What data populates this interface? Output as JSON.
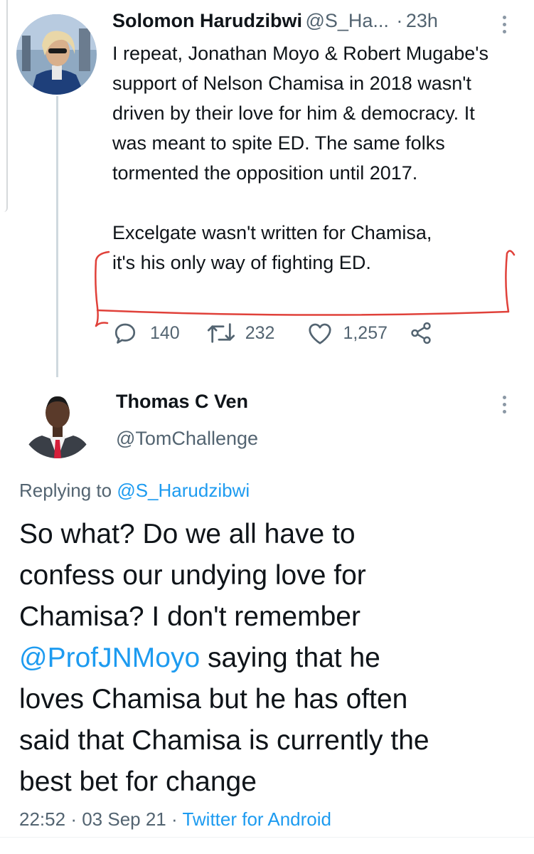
{
  "tweet1": {
    "name": "Solomon Harudzibwi",
    "handle": "@S_Ha...",
    "time_sep": "·",
    "time": "23h",
    "para1": "I repeat, Jonathan Moyo & Robert Mugabe's support of Nelson Chamisa in 2018 wasn't driven by their love for him & democracy. It was meant to spite ED. The same folks tormented the opposition until 2017.",
    "para2_line1": "Excelgate wasn't written for Chamisa,",
    "para2_line2": "it's his only way of fighting ED.",
    "replies": "140",
    "retweets": "232",
    "likes": "1,257",
    "annotation_color": "#e0413a"
  },
  "tweet2": {
    "name": "Thomas C Ven",
    "handle": "@TomChallenge",
    "replying_prefix": "Replying to",
    "replying_to": "@S_Harudzibwi",
    "text_line1": "So what? Do we all have to",
    "text_line2": "confess our undying love for",
    "text_line3": "Chamisa? I don't remember",
    "mention": "@ProfJNMoyo",
    "text_line4_rest": " saying that he",
    "text_line5": "loves Chamisa but he has often",
    "text_line6": "said that Chamisa is currently the",
    "text_line7": "best bet for change",
    "time": "22:52",
    "date": "03 Sep 21",
    "sep": "·",
    "source": "Twitter for Android"
  },
  "colors": {
    "link": "#1d9bf0",
    "muted": "#536471",
    "text": "#0f1419"
  },
  "icons": [
    "reply-icon",
    "retweet-icon",
    "like-icon",
    "share-icon",
    "more-icon"
  ]
}
